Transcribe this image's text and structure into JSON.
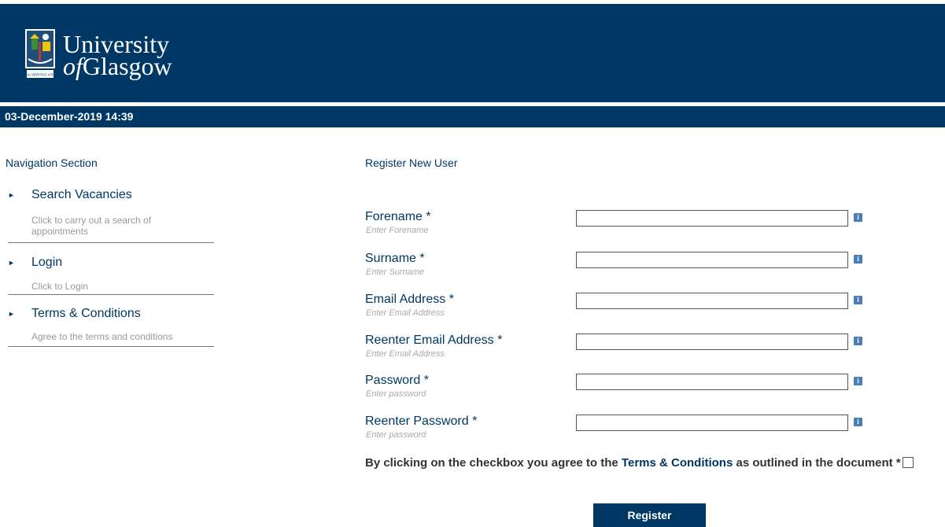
{
  "header": {
    "logo_line1": "University",
    "logo_of": "of",
    "logo_line2": "Glasgow",
    "logo_motto": "VIA VERITAS VITA",
    "brand_color": "#003865"
  },
  "datebar": {
    "datetime": "03-December-2019 14:39"
  },
  "nav": {
    "title": "Navigation Section",
    "items": [
      {
        "label": "Search Vacancies",
        "desc_line1": "Click to carry out a search of",
        "desc_line2": "appointments"
      },
      {
        "label": "Login",
        "desc_line1": "Click to Login"
      },
      {
        "label": "Terms & Conditions",
        "desc_line1": "Agree to the terms and conditions"
      }
    ]
  },
  "form": {
    "title": "Register New User",
    "fields": [
      {
        "label": "Forename *",
        "hint": "Enter Forename",
        "value": ""
      },
      {
        "label": "Surname *",
        "hint": "Enter Surname",
        "value": ""
      },
      {
        "label": "Email Address *",
        "hint": "Enter Email Address",
        "value": ""
      },
      {
        "label": "Reenter Email Address *",
        "hint": "Enter Email Address",
        "value": ""
      },
      {
        "label": "Password *",
        "hint": "Enter password",
        "value": ""
      },
      {
        "label": "Reenter Password *",
        "hint": "Enter password",
        "value": ""
      }
    ],
    "info_icon": "i",
    "agree_pre": "By clicking on the checkbox you agree to the",
    "agree_link": "Terms & Conditions",
    "agree_post": "as outlined in the document *",
    "agree_checked": false,
    "register_label": "Register"
  }
}
